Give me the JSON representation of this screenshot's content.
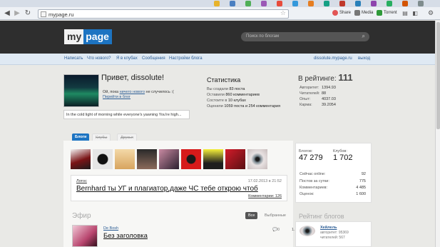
{
  "browser": {
    "url": "mypage.ru",
    "toolbar": {
      "share_label": "Share",
      "media_label": "Media",
      "torrent_label": "Torrent"
    }
  },
  "header": {
    "logo_my": "my",
    "logo_page": "page",
    "search_placeholder": "Поиск по блогам"
  },
  "nav": {
    "items": [
      "Написать",
      "Что нового?",
      "Я в клубах",
      "Сообщения",
      "Настройки блога"
    ],
    "blog_link": "dissolute.mypage.ru",
    "logout": "выход"
  },
  "profile": {
    "greeting": "Привет, dissolute!",
    "status_prefix": "Ой, пока ",
    "status_link": "ничего нового",
    "status_suffix": " не случилось :(",
    "go_to_blog": "Перейти в блог",
    "quote": "In the cold light of morning while everyone's yawning You're high..."
  },
  "stats": {
    "title": "Статистика",
    "rows": [
      {
        "label": "Вы создали ",
        "value": "83 поста",
        "suffix": ""
      },
      {
        "label": "Оставили ",
        "value": "860 комментариев",
        "suffix": ""
      },
      {
        "label": "Состоите в ",
        "value": "10 клубах",
        "suffix": ""
      },
      {
        "label": "Оценили ",
        "value": "1059 поста и 254 комментария",
        "suffix": ""
      }
    ]
  },
  "rating": {
    "label": "В рейтинге: ",
    "value": "111",
    "rows": [
      {
        "label": "Авторитет:",
        "value": "1394.93"
      },
      {
        "label": "Читателей:",
        "value": "88"
      },
      {
        "label": "Опыт:",
        "value": "4037.03"
      },
      {
        "label": "Карма:",
        "value": "39.2054"
      }
    ]
  },
  "tabs": [
    "Блоги",
    "Клубы",
    "Друзья"
  ],
  "post": {
    "author": "Лотос",
    "date": "17.02.2013 в 21:52",
    "title": "Bernhard ты УГ и плагиатор,даже ЧС тебе открою чтоб",
    "comments": "Комментарии: 126"
  },
  "feed": {
    "title": "Эфир",
    "filter_all": "Все",
    "filter_selected": "Выбранные",
    "author": "De Bosh",
    "post_title": "Без заголовка",
    "comments": "0"
  },
  "right": {
    "blogs_label": "Блогов:",
    "blogs_value": "47 279",
    "clubs_label": "Клубов:",
    "clubs_value": "1 702",
    "rows": [
      {
        "label": "Сейчас online:",
        "value": "92"
      },
      {
        "label": "Постов за сутки:",
        "value": "775"
      },
      {
        "label": "Комментариев:",
        "value": "4 485"
      },
      {
        "label": "Оценок:",
        "value": "1 600"
      }
    ],
    "rating_title": "Рейтинг блогов",
    "rank": "1.",
    "top_blog": "Хейлель",
    "top_authority": "авторитет: 95369",
    "top_readers": "читателей: 567"
  },
  "colors": {
    "accent": "#1d74c2",
    "header_bg": "#2e2e2e",
    "nav_bg": "#dfe9f3",
    "link": "#2b5c94"
  }
}
